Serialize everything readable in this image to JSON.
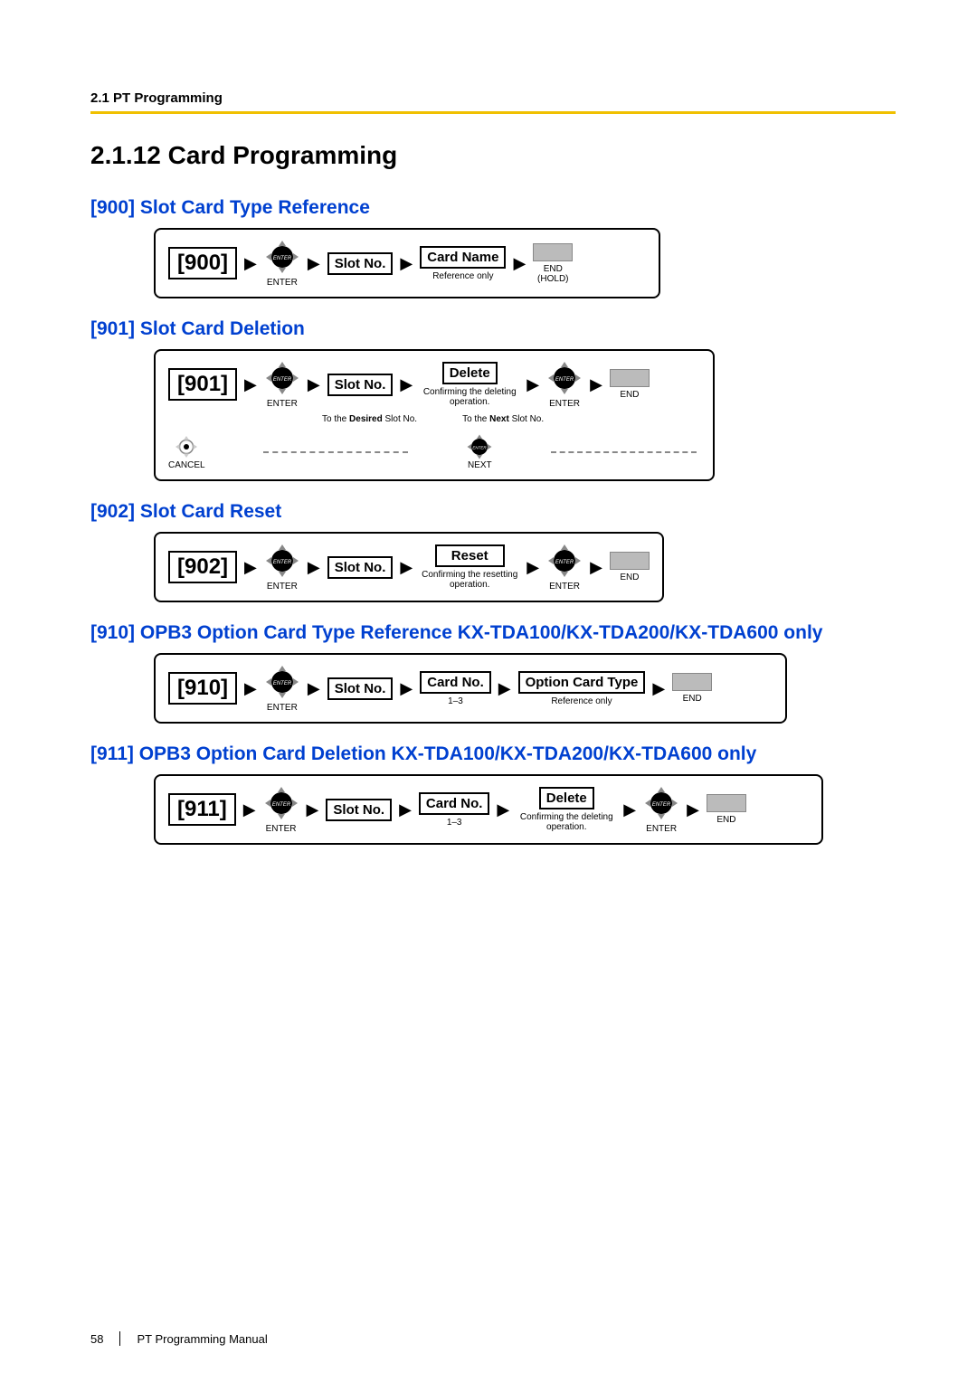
{
  "header": {
    "section": "2.1 PT Programming"
  },
  "title": "2.1.12  Card Programming",
  "sections": [
    {
      "heading": "[900] Slot Card Type Reference",
      "code": "[900]"
    },
    {
      "heading": "[901] Slot Card Deletion",
      "code": "[901]"
    },
    {
      "heading": "[902] Slot Card Reset",
      "code": "[902]"
    },
    {
      "heading": "[910] OPB3 Option Card Type Reference KX-TDA100/KX-TDA200/KX-TDA600 only",
      "code": "[910]"
    },
    {
      "heading": "[911] OPB3 Option Card Deletion KX-TDA100/KX-TDA200/KX-TDA600 only",
      "code": "[911]"
    }
  ],
  "steps": {
    "enter": "ENTER",
    "slot_no": "Slot No.",
    "card_name": "Card Name",
    "card_no": "Card No.",
    "option_card_type": "Option Card Type",
    "delete": "Delete",
    "reset": "Reset",
    "reference_only": "Reference only",
    "end": "END",
    "end_hold": "END\n(HOLD)",
    "confirm_delete": "Confirming the deleting operation.",
    "confirm_reset": "Confirming the resetting operation.",
    "one_three": "1–3",
    "cancel": "CANCEL",
    "next": "NEXT",
    "to_desired": "To the Desired Slot No.",
    "to_next": "To the Next Slot No."
  },
  "footer": {
    "page": "58",
    "manual": "PT Programming Manual"
  }
}
